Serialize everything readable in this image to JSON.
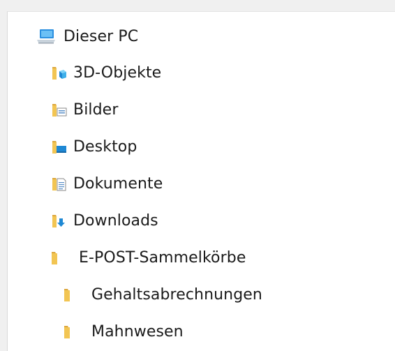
{
  "tree": {
    "root": {
      "label": "Dieser PC",
      "icon": "computer-icon"
    },
    "items": [
      {
        "label": "3D-Objekte",
        "icon": "3d-objects-folder-icon"
      },
      {
        "label": "Bilder",
        "icon": "pictures-folder-icon"
      },
      {
        "label": "Desktop",
        "icon": "desktop-folder-icon"
      },
      {
        "label": "Dokumente",
        "icon": "documents-folder-icon"
      },
      {
        "label": "Downloads",
        "icon": "downloads-folder-icon"
      },
      {
        "label": "E-POST-Sammelkörbe",
        "icon": "folder-icon"
      }
    ],
    "subitems": [
      {
        "label": "Gehaltsabrechnungen",
        "icon": "folder-icon"
      },
      {
        "label": "Mahnwesen",
        "icon": "folder-icon"
      }
    ]
  },
  "colors": {
    "folder_yellow": "#f2c553",
    "folder_dark": "#dca63b",
    "accent_blue": "#1e88d4",
    "background": "#ffffff"
  }
}
